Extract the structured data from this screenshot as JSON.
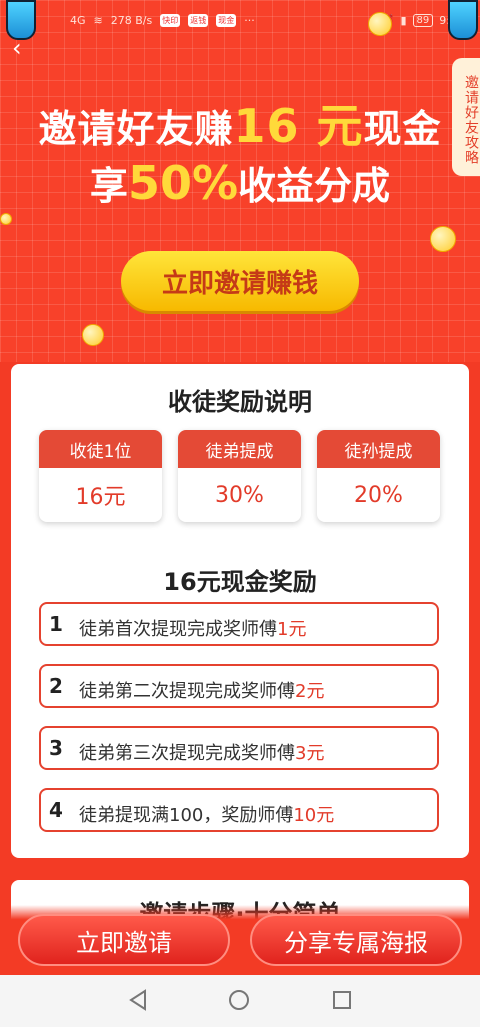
{
  "status_bar": {
    "network": "4G",
    "speed": "278 B/s",
    "app_chips": [
      "快印",
      "返钱",
      "现金"
    ],
    "battery": "89",
    "time": "9:"
  },
  "hero": {
    "title_line1_prefix": "邀请好友赚",
    "title_line1_amount": "16 元",
    "title_line1_suffix": "现金",
    "title_line2_prefix": "享",
    "title_line2_percent": "50%",
    "title_line2_suffix": "收益分成",
    "strategy_tab": "邀请好友攻略",
    "cta_label": "立即邀请赚钱"
  },
  "reward_section": {
    "title": "收徒奖励说明",
    "boxes": [
      {
        "head": "收徒1位",
        "value": "16元"
      },
      {
        "head": "徒弟提成",
        "value": "30%"
      },
      {
        "head": "徒孙提成",
        "value": "20%"
      }
    ]
  },
  "cash_section": {
    "title": "16元现金奖励",
    "steps": [
      {
        "num": "1",
        "text": "徒弟首次提现完成奖师傅",
        "amount": "1元"
      },
      {
        "num": "2",
        "text": "徒弟第二次提现完成奖师傅",
        "amount": "2元"
      },
      {
        "num": "3",
        "text": "徒弟第三次提现完成奖师傅",
        "amount": "3元"
      },
      {
        "num": "4",
        "text": "徒弟提现满100，奖励师傅",
        "amount": "10元"
      }
    ]
  },
  "next_section_peek": "邀请步骤·十分简单",
  "bottom_buttons": {
    "invite": "立即邀请",
    "share_poster": "分享专属海报"
  },
  "colors": {
    "brand_red": "#f33b25",
    "accent_yellow": "#ffd93a",
    "value_red": "#e23b2a"
  }
}
